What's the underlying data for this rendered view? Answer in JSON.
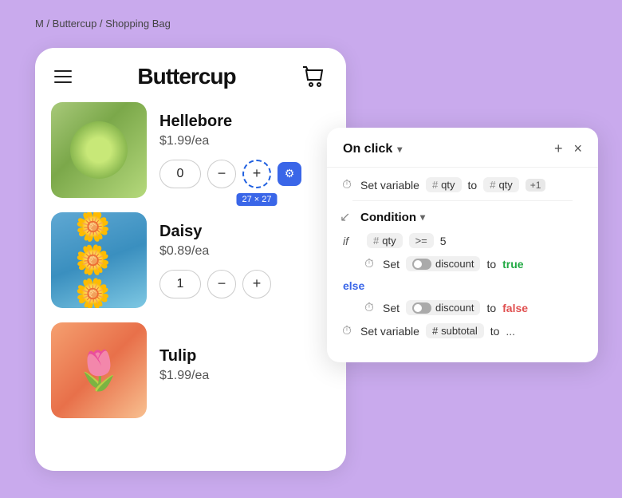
{
  "breadcrumb": {
    "text": "M / Buttercup / Shopping Bag"
  },
  "app": {
    "brand": "Buttercup",
    "products": [
      {
        "name": "Hellebore",
        "price": "$1.99/ea",
        "qty": "0",
        "imgClass": "img-hellebore",
        "highlighted": true
      },
      {
        "name": "Daisy",
        "price": "$0.89/ea",
        "qty": "1",
        "imgClass": "img-daisy",
        "highlighted": false
      },
      {
        "name": "Tulip",
        "price": "$1.99/ea",
        "qty": "",
        "imgClass": "img-tulip",
        "highlighted": false
      }
    ],
    "dim_label": "27 × 27"
  },
  "logic": {
    "title": "On click",
    "add_btn": "+",
    "close_btn": "×",
    "row1": {
      "label": "Set variable",
      "var1": "qty",
      "to_label": "to",
      "var2": "qty",
      "plus": "+1"
    },
    "condition": {
      "label": "Condition"
    },
    "if_block": {
      "keyword": "if",
      "var": "qty",
      "op": ">=",
      "val": "5"
    },
    "set_true": {
      "set": "Set",
      "toggle": "discount",
      "to": "to",
      "val": "true"
    },
    "else_label": "else",
    "set_false": {
      "set": "Set",
      "toggle": "discount",
      "to": "to",
      "val": "false"
    },
    "set_subtotal": {
      "label": "Set variable",
      "var": "subtotal",
      "to": "to",
      "val": "..."
    }
  }
}
